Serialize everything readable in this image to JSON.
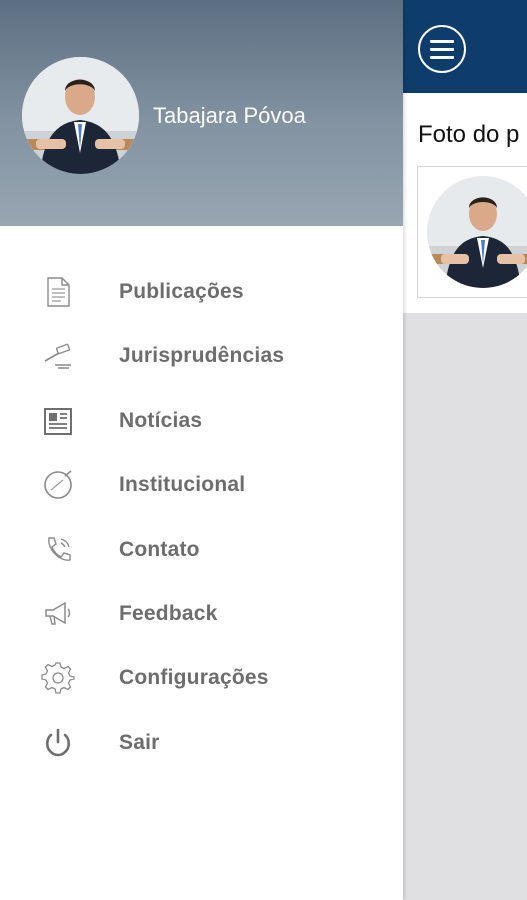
{
  "profile": {
    "name": "Tabajara Póvoa"
  },
  "menu": {
    "items": [
      {
        "label": "Publicações",
        "icon": "document-icon"
      },
      {
        "label": "Jurisprudências",
        "icon": "gavel-icon"
      },
      {
        "label": "Notícias",
        "icon": "newspaper-icon"
      },
      {
        "label": "Institucional",
        "icon": "badge-icon"
      },
      {
        "label": "Contato",
        "icon": "phone-icon"
      },
      {
        "label": "Feedback",
        "icon": "megaphone-icon"
      },
      {
        "label": "Configurações",
        "icon": "gear-icon"
      },
      {
        "label": "Sair",
        "icon": "power-icon"
      }
    ]
  },
  "content": {
    "photo_heading": "Foto do p"
  },
  "colors": {
    "app_bar": "#0f3d6b",
    "drawer_header_top": "#5c6f82",
    "menu_text": "#6d6d6d",
    "background": "#e0e0e3"
  }
}
